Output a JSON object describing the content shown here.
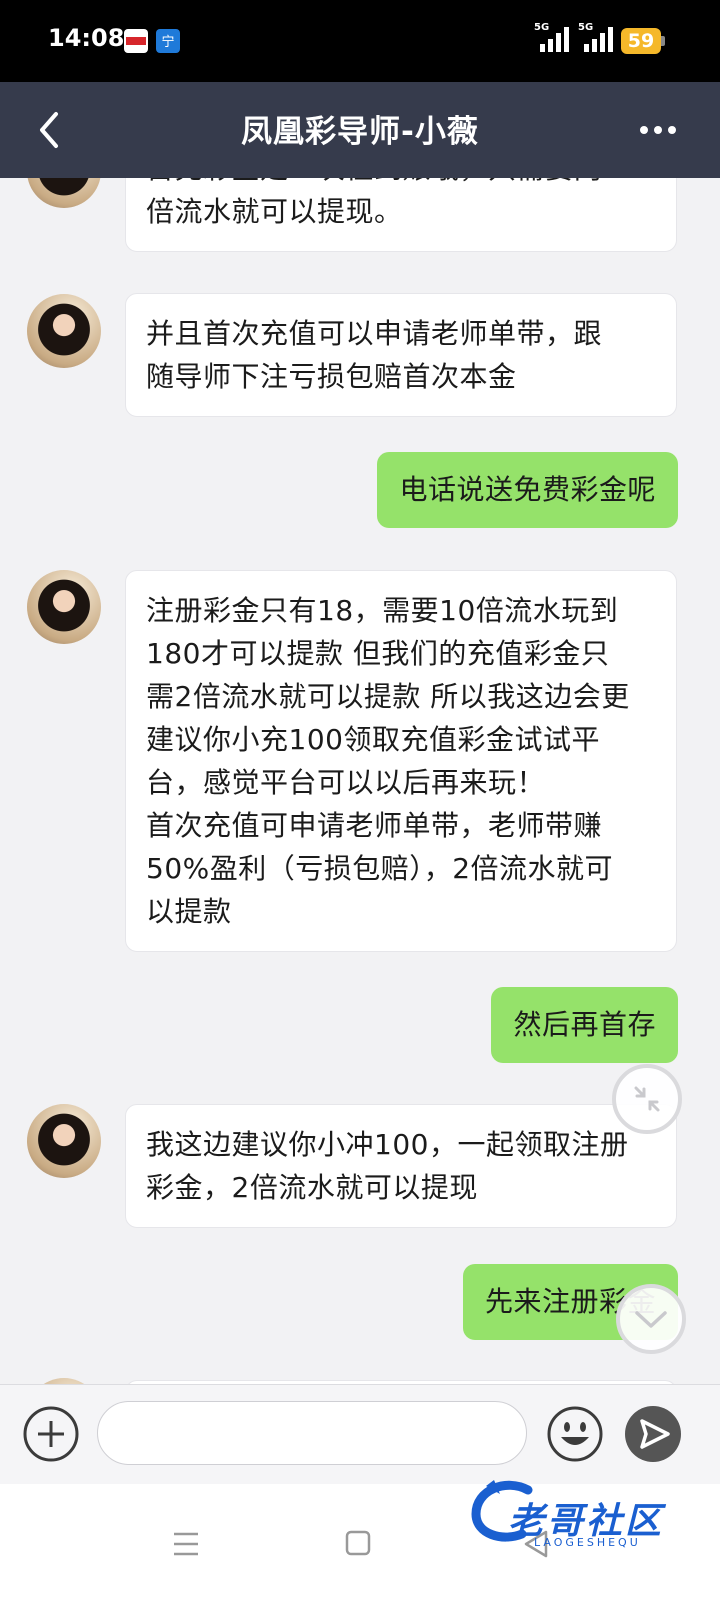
{
  "status_bar": {
    "time": "14:08",
    "signal_1": "5G",
    "signal_2": "5G",
    "battery": "59",
    "battery_color": "#f5b82a",
    "app_icons": [
      "app-icon-1",
      "app-icon-2"
    ]
  },
  "header": {
    "title": "凤凰彩导师-小薇",
    "back_icon": "chevron-left-icon",
    "more_icon": "more-horizontal-icon"
  },
  "messages": [
    {
      "from": "agent",
      "lines": [
        "首充彩金是一次性到账哦，只需要两",
        "倍流水就可以提现。"
      ]
    },
    {
      "from": "agent",
      "lines": [
        "并且首次充值可以申请老师单带，跟",
        "随导师下注亏损包赔首次本金"
      ]
    },
    {
      "from": "user",
      "text": "电话说送免费彩金呢"
    },
    {
      "from": "agent",
      "lines": [
        "注册彩金只有18，需要10倍流水玩到",
        "180才可以提款 但我们的充值彩金只",
        "需2倍流水就可以提款 所以我这边会更",
        "建议你小充100领取充值彩金试试平",
        "台，感觉平台可以以后再来玩！",
        "首次充值可申请老师单带，老师带赚",
        "50%盈利（亏损包赔），2倍流水就可",
        "以提款"
      ]
    },
    {
      "from": "user",
      "text": "然后再首存"
    },
    {
      "from": "agent",
      "lines": [
        "我这边建议你小冲100，一起领取注册",
        "彩金，2倍流水就可以提现"
      ]
    },
    {
      "from": "user",
      "text": "先来注册彩金"
    }
  ],
  "input_bar": {
    "placeholder": "",
    "plus_icon": "plus-circle-icon",
    "emoji_icon": "emoji-icon",
    "send_icon": "send-icon"
  },
  "floating": {
    "collapse_icon": "collapse-icon",
    "scroll_down_icon": "chevron-down-icon"
  },
  "watermark": {
    "text": "老哥社区",
    "sub": "LAOGESHEQU"
  },
  "colors": {
    "nav_bg": "#363b4c",
    "bubble_out": "#95e26a",
    "bubble_in": "#ffffff",
    "chat_bg": "#f2f2f4"
  }
}
